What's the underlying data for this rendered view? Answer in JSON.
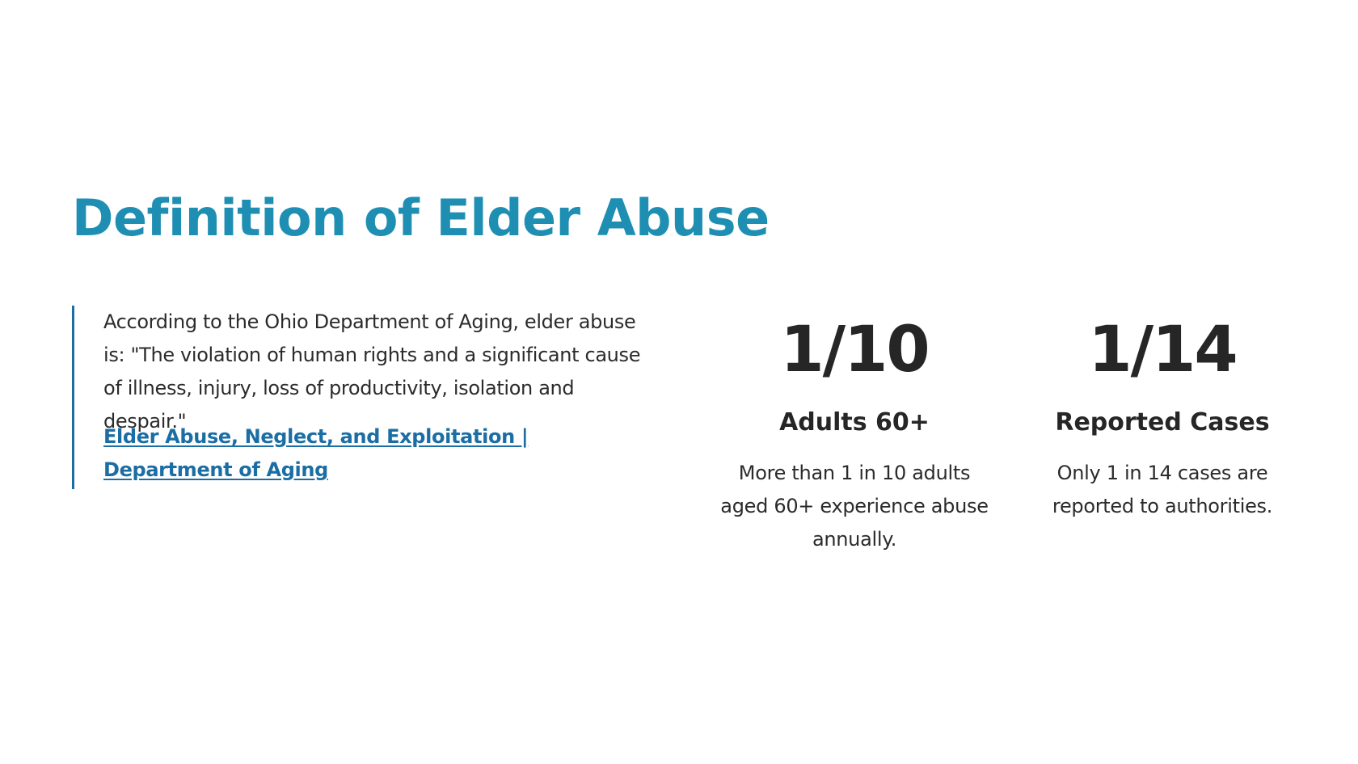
{
  "section": {
    "title": "Definition of Elder Abuse"
  },
  "quote": {
    "text": "According to the Ohio Department of Aging, elder abuse is: \"The violation of human rights and a significant cause of illness, injury, loss of productivity, isolation and despair.\"",
    "link_label": "Elder Abuse, Neglect, and Exploitation | Department of Aging"
  },
  "stats": [
    {
      "number": "1/10",
      "label": "Adults 60+",
      "description": "More than 1 in 10 adults aged 60+ experience abuse annually."
    },
    {
      "number": "1/14",
      "label": "Reported Cases",
      "description": "Only 1 in 14 cases are reported to authorities."
    }
  ],
  "colors": {
    "title": "#1e8fb3",
    "link": "#1b6ea3",
    "quote_border": "#1b6ea3",
    "text": "#2b2b2b",
    "stat": "#262626"
  }
}
